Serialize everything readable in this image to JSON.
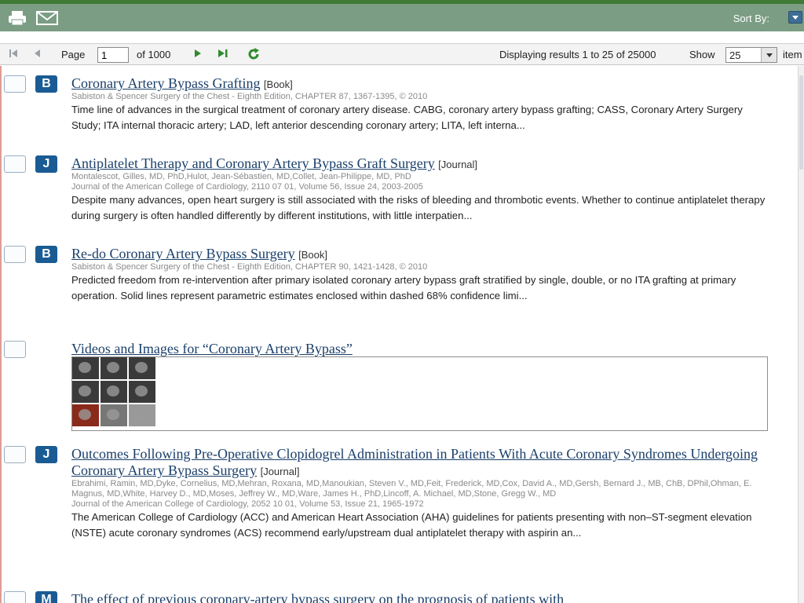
{
  "toolbar": {
    "sort_label": "Sort By:"
  },
  "pager": {
    "page_label": "Page",
    "page_value": "1",
    "of_label": "of 1000",
    "displaying": "Displaying results 1 to 25 of 25000",
    "show_label": "Show",
    "show_value": "25",
    "items_label": "item"
  },
  "results": [
    {
      "badge": "B",
      "title": "Coronary Artery Bypass Grafting",
      "kind": "[Book]",
      "meta": [
        "Sabiston & Spencer Surgery of the Chest - Eighth Edition, CHAPTER 87, 1367-1395, © 2010"
      ],
      "abstract": "Time line of advances in the surgical treatment of coronary artery disease. CABG, coronary artery bypass grafting; CASS, Coronary Artery Surgery Study; ITA internal thoracic artery; LAD, left anterior descending coronary artery; LITA, left interna..."
    },
    {
      "badge": "J",
      "title": "Antiplatelet Therapy and Coronary Artery Bypass Graft Surgery",
      "kind": "[Journal]",
      "meta": [
        "Montalescot, Gilles, MD, PhD,Hulot, Jean-Sébastien, MD,Collet, Jean-Philippe, MD, PhD",
        "Journal of the American College of Cardiology, 2110 07 01, Volume 56, Issue 24, 2003-2005"
      ],
      "abstract": "Despite many advances, open heart surgery is still associated with the risks of bleeding and thrombotic events. Whether to continue antiplatelet therapy during surgery is often handled differently by different institutions, with little interpatien..."
    },
    {
      "badge": "B",
      "title": "Re-do Coronary Artery Bypass Surgery",
      "kind": "[Book]",
      "meta": [
        "Sabiston & Spencer Surgery of the Chest - Eighth Edition, CHAPTER 90, 1421-1428, © 2010"
      ],
      "abstract": "Predicted freedom from re-intervention after primary isolated coronary artery bypass graft stratified by single, double, or no ITA grafting at primary operation. Solid lines represent parametric estimates enclosed within dashed 68% confidence limi..."
    },
    {
      "badge": "",
      "title": "Videos and Images for “Coronary Artery Bypass”",
      "kind": "",
      "meta": [],
      "abstract": ""
    },
    {
      "badge": "J",
      "title": "Outcomes Following Pre-Operative Clopidogrel Administration in Patients With Acute Coronary Syndromes Undergoing Coronary Artery Bypass Surgery",
      "kind": "[Journal]",
      "meta": [
        "Ebrahimi, Ramin, MD,Dyke, Cornelius, MD,Mehran, Roxana, MD,Manoukian, Steven V., MD,Feit, Frederick, MD,Cox, David A., MD,Gersh, Bernard J., MB, ChB, DPhil,Ohman, E. Magnus, MD,White, Harvey D., MD,Moses, Jeffrey W., MD,Ware, James H., PhD,Lincoff, A. Michael, MD,Stone, Gregg W., MD",
        "Journal of the American College of Cardiology, 2052 10 01, Volume 53, Issue 21, 1965-1972"
      ],
      "abstract": "The American College of Cardiology (ACC) and American Heart Association (AHA) guidelines for patients presenting with non–ST-segment elevation (NSTE) acute coronary syndromes (ACS) recommend early/upstream dual antiplatelet therapy with aspirin an..."
    },
    {
      "badge": "M",
      "title": "The effect of previous coronary-artery bypass surgery on the prognosis of patients with",
      "kind": "",
      "meta": [],
      "abstract": ""
    }
  ]
}
